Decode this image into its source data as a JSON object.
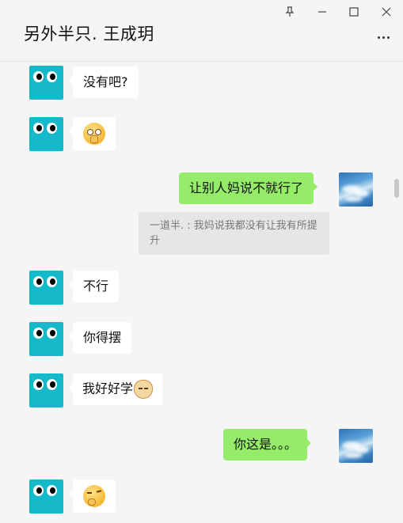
{
  "window": {
    "title": "另外半只. 王成玥",
    "controls": [
      "pin-icon",
      "minimize-icon",
      "maximize-icon",
      "close-icon"
    ],
    "more_icon": "more-icon"
  },
  "messages": [
    {
      "side": "in",
      "text": "没有吧?"
    },
    {
      "side": "in",
      "emoji": "shushing-face"
    },
    {
      "side": "out",
      "text": "让别人妈说不就行了",
      "quote": "一道半. : 我妈说我都没有让我有所提升"
    },
    {
      "side": "in",
      "text": "不行"
    },
    {
      "side": "in",
      "text": "你得摆"
    },
    {
      "side": "in",
      "text": "我好好学",
      "emoji": "doge"
    },
    {
      "side": "out",
      "text": "你这是。。。"
    },
    {
      "side": "in",
      "emoji": "thinking-face"
    }
  ],
  "colors": {
    "background": "#f5f5f5",
    "incoming_bubble": "#ffffff",
    "outgoing_bubble": "#95ec69",
    "quote_bg": "#e6e6e6",
    "bot_avatar": "#16b9c9"
  }
}
